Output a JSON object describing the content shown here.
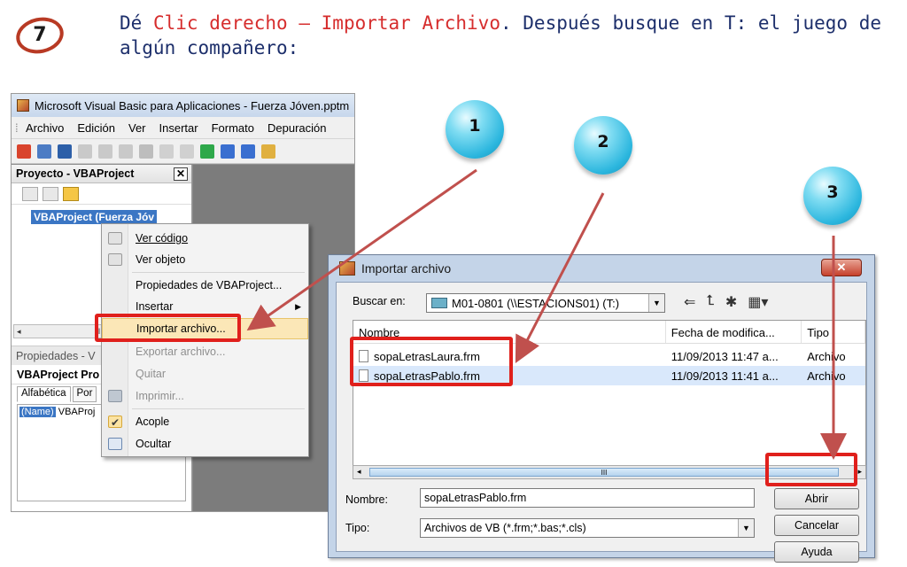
{
  "step": {
    "number": "7"
  },
  "instruction": {
    "part1": "Dé ",
    "highlight": "Clic derecho – Importar Archivo",
    "part2": ". Después busque en T: el juego de algún compañero:"
  },
  "vba_window": {
    "title": "Microsoft Visual Basic para Aplicaciones - Fuerza Jóven.pptm",
    "menu": [
      "Archivo",
      "Edición",
      "Ver",
      "Insertar",
      "Formato",
      "Depuración"
    ],
    "project_panel": {
      "title": "Proyecto - VBAProject",
      "close": "✕",
      "node": "VBAProject (Fuerza Jóv"
    },
    "hscroll_mark": "III",
    "properties_panel": {
      "title": "Propiedades - V",
      "object": "VBAProject Pro",
      "tabs": [
        "Alfabética",
        "Por"
      ],
      "row_key": "(Name)",
      "row_value": "VBAProj"
    }
  },
  "context_menu": {
    "items": [
      {
        "label": "Ver código",
        "disabled": false
      },
      {
        "label": "Ver objeto",
        "disabled": false
      },
      {
        "label": "Propiedades de VBAProject...",
        "disabled": false
      },
      {
        "label": "Insertar",
        "disabled": false
      },
      {
        "label": "Importar archivo...",
        "disabled": false
      },
      {
        "label": "Exportar archivo...",
        "disabled": true
      },
      {
        "label": "Quitar",
        "disabled": true
      },
      {
        "label": "Imprimir...",
        "disabled": true
      },
      {
        "label": "Acople",
        "disabled": false
      },
      {
        "label": "Ocultar",
        "disabled": false
      }
    ]
  },
  "dialog": {
    "title": "Importar archivo",
    "close": "✕",
    "lookin_label": "Buscar en:",
    "lookin_value": "M01-0801 (\\\\ESTACIONS01) (T:)",
    "columns": [
      "Nombre",
      "Fecha de modifica...",
      "Tipo"
    ],
    "files": [
      {
        "name": "sopaLetrasLaura.frm",
        "date": "11/09/2013 11:47 a...",
        "type": "Archivo"
      },
      {
        "name": "sopaLetrasPablo.frm",
        "date": "11/09/2013 11:41 a...",
        "type": "Archivo"
      }
    ],
    "hscroll_mark": "III",
    "name_label": "Nombre:",
    "name_value": "sopaLetrasPablo.frm",
    "type_label": "Tipo:",
    "type_value": "Archivos de VB (*.frm;*.bas;*.cls)",
    "buttons": {
      "open": "Abrir",
      "cancel": "Cancelar",
      "help": "Ayuda"
    }
  },
  "callouts": [
    "1",
    "2",
    "3"
  ],
  "colors": {
    "highlight_red": "#e0201c",
    "instruction_blue": "#1d2f6b",
    "callout_blue": "#2bb6de"
  }
}
